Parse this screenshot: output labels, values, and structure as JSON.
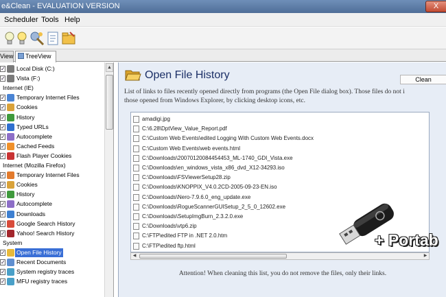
{
  "window": {
    "title": "e&Clean - EVALUATION VERSION",
    "close_label": "X"
  },
  "menu": {
    "items": [
      "Scheduler",
      "Tools",
      "Help"
    ]
  },
  "tabs": [
    {
      "label": "View"
    },
    {
      "label": "TreeView"
    }
  ],
  "tree": [
    {
      "label": "Local Disk (C:)",
      "checked": true,
      "icon": "drive-icon",
      "indent": 1,
      "color": "#7a7a7a"
    },
    {
      "label": "Vista (F:)",
      "checked": true,
      "icon": "drive-icon",
      "indent": 1,
      "color": "#7a7a7a"
    },
    {
      "label": "Internet (IE)",
      "checked": false,
      "icon": "",
      "indent": 0,
      "color": ""
    },
    {
      "label": "Temporary Internet Files",
      "checked": true,
      "icon": "ie-icon",
      "indent": 1,
      "color": "#4a84d4"
    },
    {
      "label": "Cookies",
      "checked": true,
      "icon": "cookie-icon",
      "indent": 1,
      "color": "#d9a23a"
    },
    {
      "label": "History",
      "checked": true,
      "icon": "history-icon",
      "indent": 1,
      "color": "#3f9a3c"
    },
    {
      "label": "Typed URLs",
      "checked": true,
      "icon": "url-icon",
      "indent": 1,
      "color": "#2f6fcf"
    },
    {
      "label": "Autocomplete",
      "checked": true,
      "icon": "autocomplete-icon",
      "indent": 1,
      "color": "#8d6ec7"
    },
    {
      "label": "Cached Feeds",
      "checked": true,
      "icon": "feed-icon",
      "indent": 1,
      "color": "#f0902a"
    },
    {
      "label": "Flash Player Cookies",
      "checked": true,
      "icon": "flash-icon",
      "indent": 1,
      "color": "#c83232"
    },
    {
      "label": "Internet (Mozilla Firefox)",
      "checked": false,
      "icon": "",
      "indent": 0,
      "color": ""
    },
    {
      "label": "Temporary Internet Files",
      "checked": true,
      "icon": "firefox-icon",
      "indent": 1,
      "color": "#e27a2c"
    },
    {
      "label": "Cookies",
      "checked": true,
      "icon": "cookie-icon",
      "indent": 1,
      "color": "#d9a23a"
    },
    {
      "label": "History",
      "checked": true,
      "icon": "history-icon",
      "indent": 1,
      "color": "#3f9a3c"
    },
    {
      "label": "Autocomplete",
      "checked": true,
      "icon": "autocomplete-icon",
      "indent": 1,
      "color": "#8d6ec7"
    },
    {
      "label": "Downloads",
      "checked": true,
      "icon": "download-icon",
      "indent": 1,
      "color": "#3d7fd1"
    },
    {
      "label": "Google Search History",
      "checked": true,
      "icon": "google-icon",
      "indent": 1,
      "color": "#d84b3a"
    },
    {
      "label": "Yahoo! Search History",
      "checked": true,
      "icon": "yahoo-icon",
      "indent": 1,
      "color": "#a3262c"
    },
    {
      "label": "System",
      "checked": false,
      "icon": "",
      "indent": 0,
      "color": ""
    },
    {
      "label": "Open File History",
      "checked": true,
      "icon": "folder-icon",
      "indent": 1,
      "color": "#e8b93a",
      "selected": true
    },
    {
      "label": "Recent Documents",
      "checked": true,
      "icon": "document-icon",
      "indent": 1,
      "color": "#5f8fd0"
    },
    {
      "label": "System registry traces",
      "checked": true,
      "icon": "registry-icon",
      "indent": 1,
      "color": "#4aa0c8"
    },
    {
      "label": "MFU registry traces",
      "checked": true,
      "icon": "registry-icon",
      "indent": 1,
      "color": "#4aa0c8"
    }
  ],
  "main": {
    "title": "Open File History",
    "clean_label": "Clean",
    "description_line1": "List of links to files recently opened directly from programs (the Open File dialog box). Those files do not i",
    "description_line2": "those opened from Windows Explorer, by clicking desktop icons, etc.",
    "files": [
      "amadigi.jpg",
      "C:\\6.28\\DptView_Value_Report.pdf",
      "C:\\Custom Web Events\\edited Logging With Custom Web Events.docx",
      "C:\\Custom Web Events\\web events.html",
      "C:\\Downloads\\20070120084454453_ML-1740_GDI_Vista.exe",
      "C:\\Downloads\\en_windows_vista_x86_dvd_X12-34293.iso",
      "C:\\Downloads\\FSViewerSetup28.zip",
      "C:\\Downloads\\KNOPPIX_V4.0.2CD-2005-09-23-EN.iso",
      "C:\\Downloads\\Nero-7.9.6.0_eng_update.exe",
      "C:\\Downloads\\RogueScannerGUISetup_2_5_0_12602.exe",
      "C:\\Downloads\\SetupImgBurn_2.3.2.0.exe",
      "C:\\Downloads\\vtp6.zip",
      "C:\\FTP\\edited FTP in .NET 2.0.htm",
      "C:\\FTP\\edited ftp.html"
    ],
    "attention": "Attention! When cleaning this list, you do not remove the files, only their links."
  },
  "overlay": {
    "badge": "+ Portab"
  },
  "colors": {
    "title_blue": "#1b2f66",
    "selection": "#3a6fd6",
    "panel_bg": "#e7edf6"
  }
}
